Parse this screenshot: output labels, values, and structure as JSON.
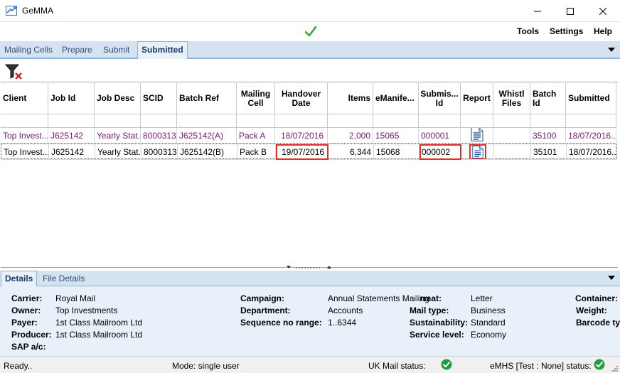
{
  "window": {
    "title": "GeMMA"
  },
  "menu": {
    "tools": "Tools",
    "settings": "Settings",
    "help": "Help"
  },
  "tabs": [
    {
      "label": "Mailing Cells"
    },
    {
      "label": "Prepare"
    },
    {
      "label": "Submit"
    },
    {
      "label": "Submitted"
    }
  ],
  "grid": {
    "columns": [
      {
        "label": "Client"
      },
      {
        "label": "Job Id"
      },
      {
        "label": "Job Desc"
      },
      {
        "label": "SCID"
      },
      {
        "label": "Batch Ref"
      },
      {
        "label": "Mailing Cell"
      },
      {
        "label": "Handover Date"
      },
      {
        "label": "Items"
      },
      {
        "label": "eManife..."
      },
      {
        "label": "Submis... Id"
      },
      {
        "label": "Report"
      },
      {
        "label": "Whistl Files"
      },
      {
        "label": "Batch Id"
      },
      {
        "label": "Submitted"
      }
    ],
    "rows": [
      {
        "client": "Top Invest...",
        "job_id": "J625142",
        "job_desc": "Yearly Stat...",
        "scid": "8000313",
        "batch_ref": "J625142(A)",
        "mailing_cell": "Pack A",
        "handover_date": "18/07/2016",
        "items": "2,000",
        "emanifest": "15065",
        "submission_id": "000001",
        "whistl_files": "",
        "batch_id": "35100",
        "submitted": "18/07/2016..."
      },
      {
        "client": "Top Invest...",
        "job_id": "J625142",
        "job_desc": "Yearly Stat...",
        "scid": "8000313",
        "batch_ref": "J625142(B)",
        "mailing_cell": "Pack B",
        "handover_date": "19/07/2016",
        "items": "6,344",
        "emanifest": "15068",
        "submission_id": "000002",
        "whistl_files": "",
        "batch_id": "35101",
        "submitted": "18/07/2016..."
      }
    ]
  },
  "details_tabs": [
    {
      "label": "Details"
    },
    {
      "label": "File Details"
    }
  ],
  "details": {
    "carrier_label": "Carrier:",
    "carrier": "Royal Mail",
    "owner_label": "Owner:",
    "owner": "Top Investments",
    "payer_label": "Payer:",
    "payer": "1st Class Mailroom Ltd",
    "producer_label": "Producer:",
    "producer": "1st Class Mailroom Ltd",
    "sap_label": "SAP a/c:",
    "campaign_label": "Campaign:",
    "campaign": "Annual Statements Mailing",
    "department_label": "Department:",
    "department": "Accounts",
    "seq_label": "Sequence no range:",
    "seq": "1..6344",
    "format_label": "rmat:",
    "format": "Letter",
    "mailtype_label": "Mail type:",
    "mailtype": "Business",
    "sustainability_label": "Sustainability:",
    "sustainability": "Standard",
    "service_label": "Service level:",
    "service": "Economy",
    "container_label": "Container:",
    "weight_label": "Weight:",
    "barcode_label": "Barcode ty"
  },
  "status": {
    "ready": "Ready..",
    "mode": "Mode: single user",
    "uk_mail": "UK Mail status:",
    "emhs": "eMHS [Test : None] status:"
  },
  "colors": {
    "accent": "#2f4f7f",
    "tab_bg": "#d5e2f0",
    "details_bg": "#e8f0fa",
    "row_text_purple": "#7a1a7a",
    "ok_green": "#1e9e3e",
    "highlight_red": "#e03030"
  },
  "icons": {
    "app": "gemma-logo-icon",
    "status_ok": "green-check-icon",
    "filter_clear": "filter-clear-icon",
    "report": "report-document-icon"
  }
}
